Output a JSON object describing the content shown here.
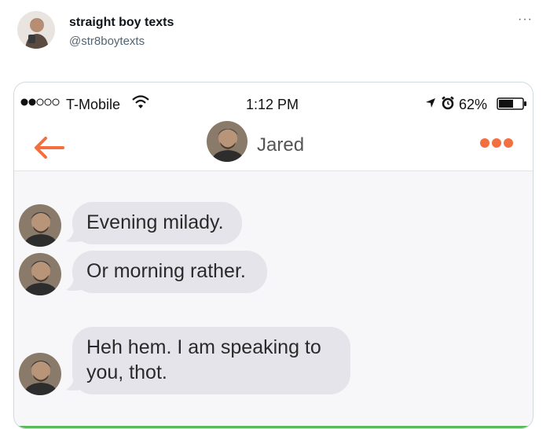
{
  "tweet": {
    "display_name": "straight boy texts",
    "handle": "@str8boytexts",
    "more_icon": "more-horizontal-icon"
  },
  "phone": {
    "status_bar": {
      "signal_bars": 5,
      "signal_filled": 2,
      "carrier": "T-Mobile",
      "time": "1:12 PM",
      "battery": "62%",
      "battery_level": 0.62
    },
    "nav": {
      "back_icon": "back-arrow-icon",
      "contact_name": "Jared",
      "options_icon": "more-dots-icon"
    },
    "messages": [
      {
        "text": "Evening milady."
      },
      {
        "text": "Or morning rather."
      },
      {
        "text": "Heh hem.  I am speaking to you,  thot."
      }
    ]
  },
  "colors": {
    "accent": "#f26f3f",
    "bubble": "#e5e4ea",
    "chat_background": "#f7f6f8"
  }
}
